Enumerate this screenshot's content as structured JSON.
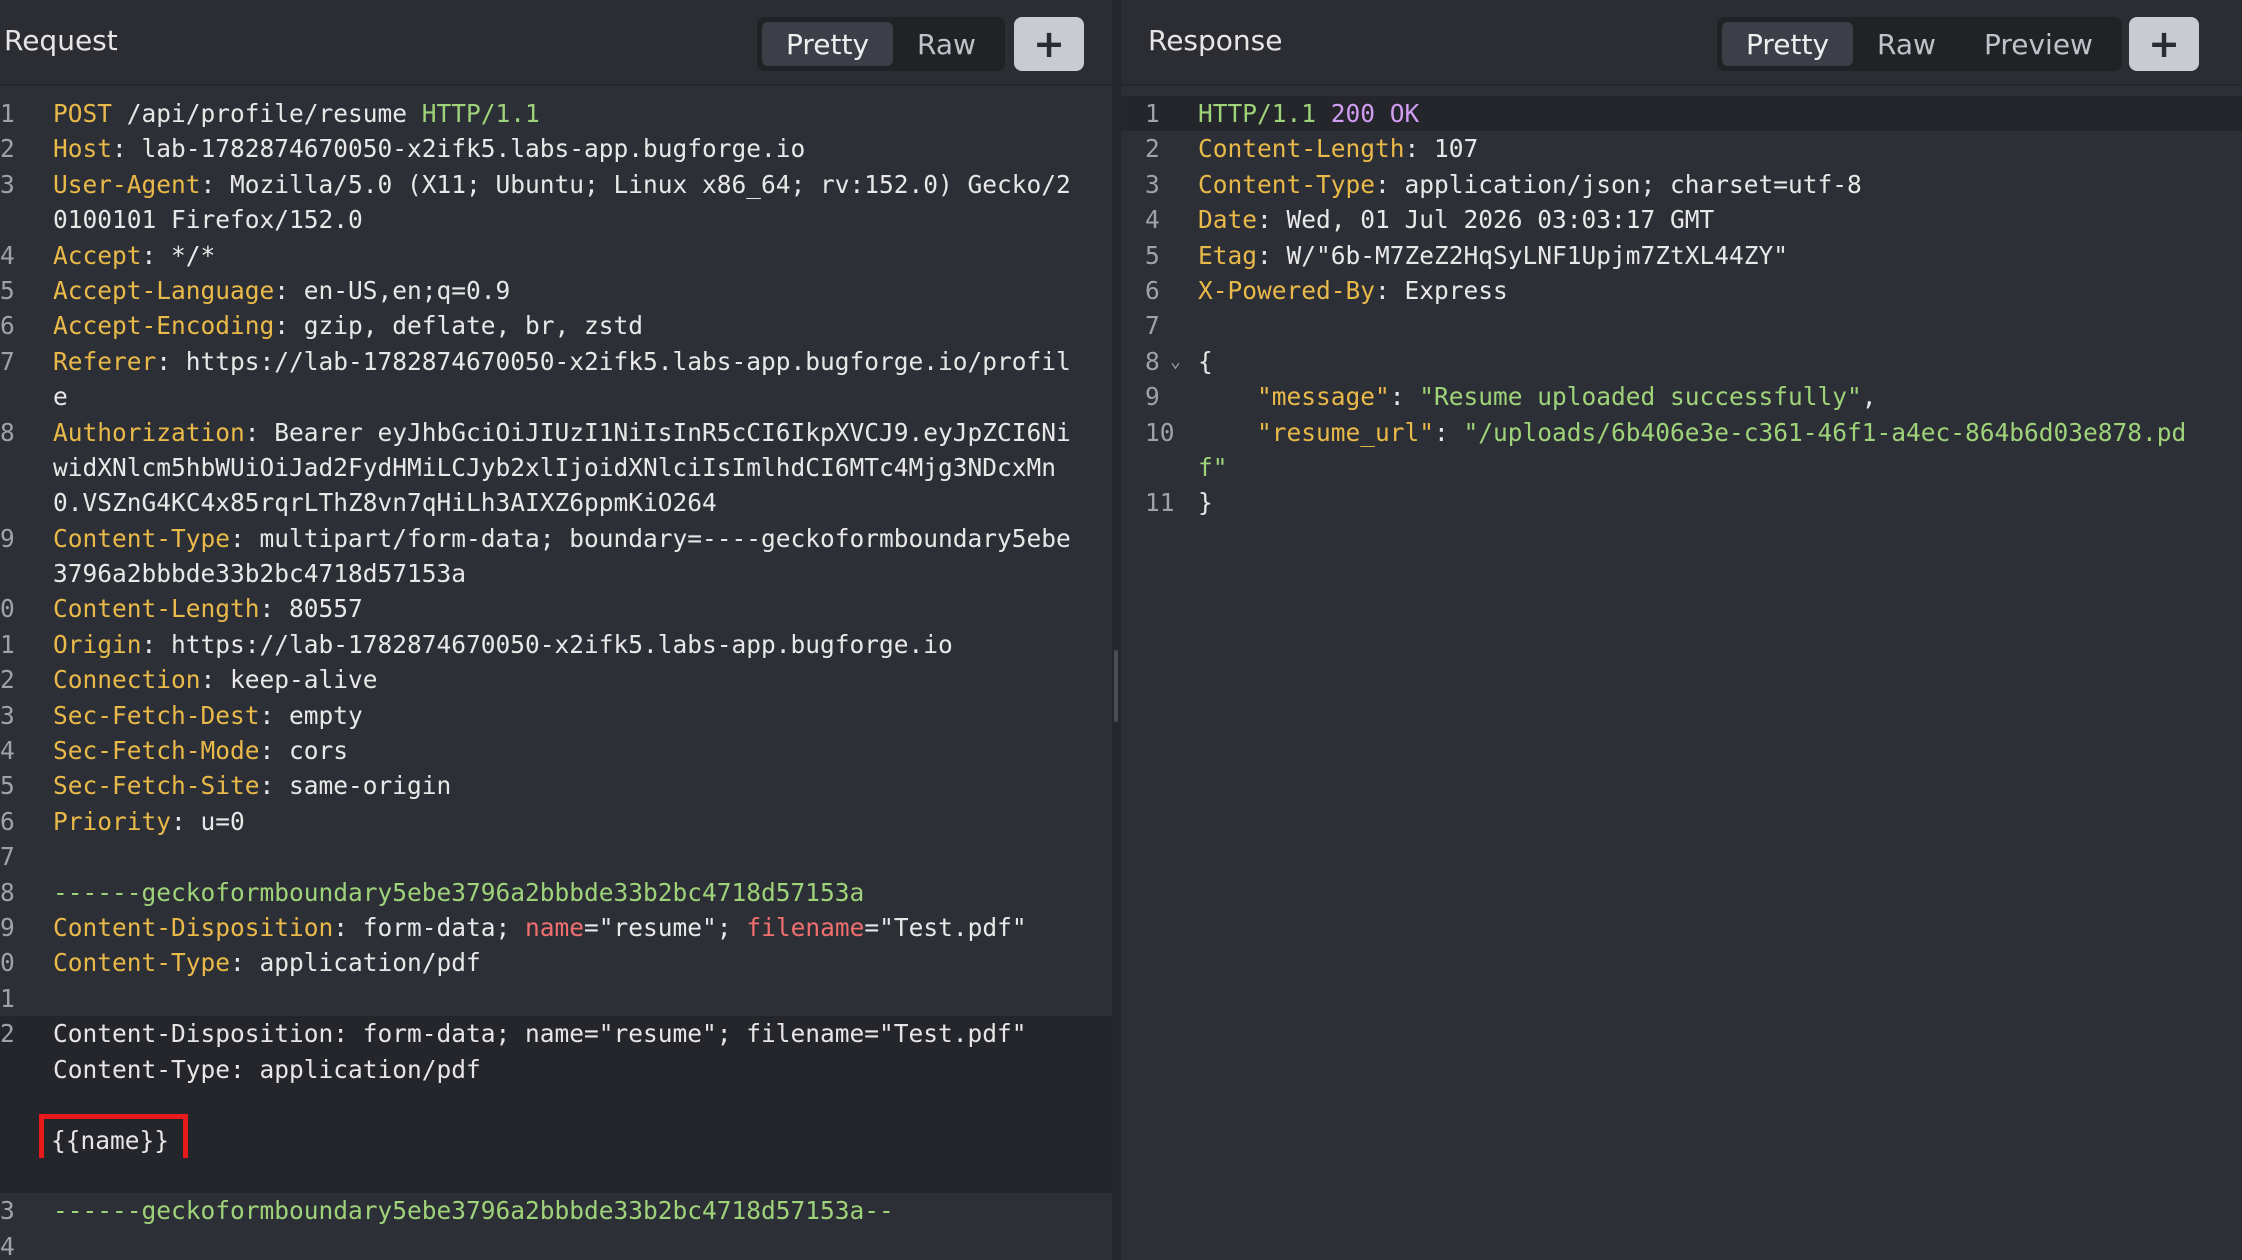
{
  "request": {
    "title": "Request",
    "tabs": [
      "Pretty",
      "Raw"
    ],
    "active_tab": "Pretty",
    "plus_label": "+",
    "lines": [
      {
        "num": "1",
        "method": "POST",
        "path": " /api/profile/resume ",
        "proto": "HTTP/1.1"
      },
      {
        "num": "2",
        "key": "Host",
        "value": ": lab-1782874670050-x2ifk5.labs-app.bugforge.io"
      },
      {
        "num": "3",
        "key": "User-Agent",
        "value": ": Mozilla/5.0 (X11; Ubuntu; Linux x86_64; rv:152.0) Gecko/2"
      },
      {
        "num": "",
        "value": "0100101 Firefox/152.0"
      },
      {
        "num": "4",
        "key": "Accept",
        "value": ": */*"
      },
      {
        "num": "5",
        "key": "Accept-Language",
        "value": ": en-US,en;q=0.9"
      },
      {
        "num": "6",
        "key": "Accept-Encoding",
        "value": ": gzip, deflate, br, zstd"
      },
      {
        "num": "7",
        "key": "Referer",
        "value": ": https://lab-1782874670050-x2ifk5.labs-app.bugforge.io/profil"
      },
      {
        "num": "",
        "value": "e"
      },
      {
        "num": "8",
        "key": "Authorization",
        "value": ": Bearer eyJhbGciOiJIUzI1NiIsInR5cCI6IkpXVCJ9.eyJpZCI6Ni"
      },
      {
        "num": "",
        "value": "widXNlcm5hbWUiOiJad2FydHMiLCJyb2xlIjoidXNlciIsImlhdCI6MTc4Mjg3NDcxMn"
      },
      {
        "num": "",
        "value": "0.VSZnG4KC4x85rqrLThZ8vn7qHiLh3AIXZ6ppmKiO264"
      },
      {
        "num": "9",
        "key": "Content-Type",
        "value": ": multipart/form-data; boundary=----geckoformboundary5ebe"
      },
      {
        "num": "",
        "value": "3796a2bbbde33b2bc4718d57153a"
      },
      {
        "num": "0",
        "key": "Content-Length",
        "value": ": 80557"
      },
      {
        "num": "1",
        "key": "Origin",
        "value": ": https://lab-1782874670050-x2ifk5.labs-app.bugforge.io"
      },
      {
        "num": "2",
        "key": "Connection",
        "value": ": keep-alive"
      },
      {
        "num": "3",
        "key": "Sec-Fetch-Dest",
        "value": ": empty"
      },
      {
        "num": "4",
        "key": "Sec-Fetch-Mode",
        "value": ": cors"
      },
      {
        "num": "5",
        "key": "Sec-Fetch-Site",
        "value": ": same-origin"
      },
      {
        "num": "6",
        "key": "Priority",
        "value": ": u=0"
      },
      {
        "num": "7"
      },
      {
        "num": "8",
        "boundary": "------geckoformboundary5ebe3796a2bbbde33b2bc4718d57153a"
      },
      {
        "num": "9",
        "key": "Content-Disposition",
        "value": ": form-data; ",
        "attr1": "name",
        "val1": "=\"resume\"; ",
        "attr2": "filename",
        "val2": "=\"Test.pdf\""
      },
      {
        "num": "0",
        "key": "Content-Type",
        "value": ": application/pdf"
      },
      {
        "num": "1"
      },
      {
        "num": "2",
        "plain": "Content-Disposition: form-data; name=\"resume\"; filename=\"Test.pdf\"",
        "hl": true
      },
      {
        "num": "",
        "plain": "Content-Type: application/pdf",
        "hl": true
      },
      {
        "num": "",
        "hl": true
      },
      {
        "num": "",
        "template": "{{name}}",
        "hl": true
      },
      {
        "num": "",
        "hl": true
      },
      {
        "num": "3",
        "boundary": "------geckoformboundary5ebe3796a2bbbde33b2bc4718d57153a--"
      },
      {
        "num": "4"
      }
    ]
  },
  "response": {
    "title": "Response",
    "tabs": [
      "Pretty",
      "Raw",
      "Preview"
    ],
    "active_tab": "Pretty",
    "plus_label": "+",
    "lines": [
      {
        "num": "1",
        "proto": "HTTP/1.1",
        "status": " 200 OK",
        "hl": true
      },
      {
        "num": "2",
        "key": "Content-Length",
        "value": ": 107"
      },
      {
        "num": "3",
        "key": "Content-Type",
        "value": ": application/json; charset=utf-8"
      },
      {
        "num": "4",
        "key": "Date",
        "value": ": Wed, 01 Jul 2026 03:03:17 GMT"
      },
      {
        "num": "5",
        "key": "Etag",
        "value": ": W/\"6b-M7ZeZ2HqSyLNF1Upjm7ZtXL44ZY\""
      },
      {
        "num": "6",
        "key": "X-Powered-By",
        "value": ": Express"
      },
      {
        "num": "7"
      },
      {
        "num": "8",
        "plain": "{",
        "fold": "⌄"
      },
      {
        "num": "9",
        "jkey": "    \"message\"",
        "jsep": ": ",
        "jval": "\"Resume uploaded successfully\"",
        "jend": ","
      },
      {
        "num": "10",
        "jkey": "    \"resume_url\"",
        "jsep": ": ",
        "jval": "\"/uploads/6b406e3e-c361-46f1-a4ec-864b6d03e878.pd"
      },
      {
        "num": "",
        "jval": "f\""
      },
      {
        "num": "11",
        "plain": "}"
      }
    ]
  },
  "colors": {
    "header_key": "#e9b949",
    "green": "#9fd37a",
    "red_attr": "#f06f6f",
    "highlight_box": "#ea1a1a"
  }
}
